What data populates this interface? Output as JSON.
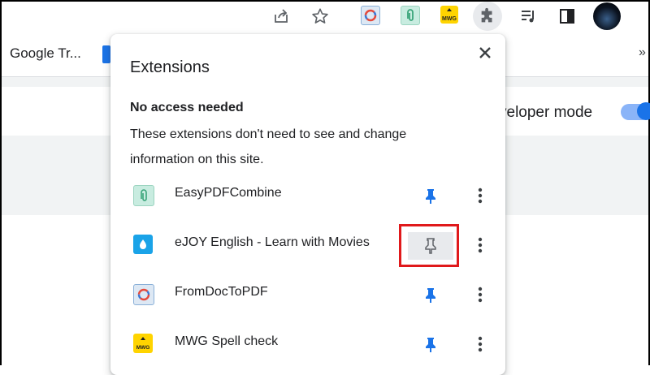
{
  "toolbar": {
    "icons": [
      "share-icon",
      "star-icon",
      "fromdoctopdf-extension-icon",
      "easypdfcombine-extension-icon",
      "mwg-extension-icon",
      "extensions-puzzle-icon",
      "media-control-icon",
      "side-panel-icon",
      "profile-avatar"
    ],
    "mwg_badge": "MWG"
  },
  "bookmarks": {
    "google_translate": "Google Tr...",
    "overflow": "»"
  },
  "page": {
    "developer_mode_label": "veloper mode",
    "developer_mode_on": true
  },
  "popup": {
    "title": "Extensions",
    "section_heading": "No access needed",
    "section_description": "These extensions don't need to see and change information on this site.",
    "extensions": [
      {
        "name": "EasyPDFCombine",
        "pinned": true,
        "icon": "easypdfcombine-icon"
      },
      {
        "name": "eJOY English - Learn with Movies",
        "pinned": false,
        "icon": "ejoy-icon"
      },
      {
        "name": "FromDocToPDF",
        "pinned": true,
        "icon": "fromdoctopdf-icon"
      },
      {
        "name": "MWG Spell check",
        "pinned": true,
        "icon": "mwg-icon"
      }
    ]
  },
  "colors": {
    "accent": "#1a73e8",
    "highlight": "#e0191b"
  }
}
